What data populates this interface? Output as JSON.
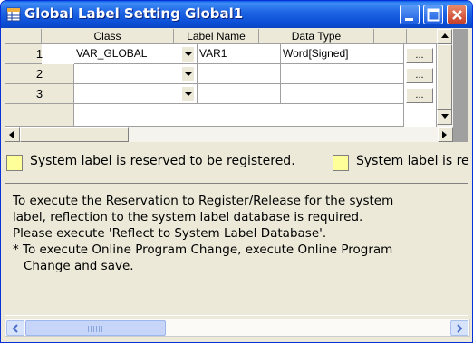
{
  "window": {
    "title": "Global Label Setting Global1",
    "title_icon": "table-grid-icon",
    "buttons": [
      "minimize-icon",
      "maximize-icon",
      "close-icon"
    ]
  },
  "grid": {
    "columns": [
      "",
      "Class",
      "Label Name",
      "Data Type",
      "",
      ""
    ],
    "rows": [
      {
        "num": "1",
        "class": "VAR_GLOBAL",
        "label": "VAR1",
        "type": "Word[Signed]",
        "btn": "..."
      },
      {
        "num": "2",
        "class": "",
        "label": "",
        "type": "",
        "btn": "..."
      },
      {
        "num": "3",
        "class": "",
        "label": "",
        "type": "",
        "btn": "..."
      }
    ]
  },
  "legend": {
    "item1": "System label is reserved to be registered.",
    "item2": "System label is re",
    "color": "#ffff99"
  },
  "message": {
    "lines": [
      "To execute the Reservation to Register/Release for the system",
      "label, reflection to the system label database is required.",
      "Please execute 'Reflect to System Label Database'.",
      "* To execute Online Program Change, execute Online Program",
      "  Change and save."
    ]
  }
}
